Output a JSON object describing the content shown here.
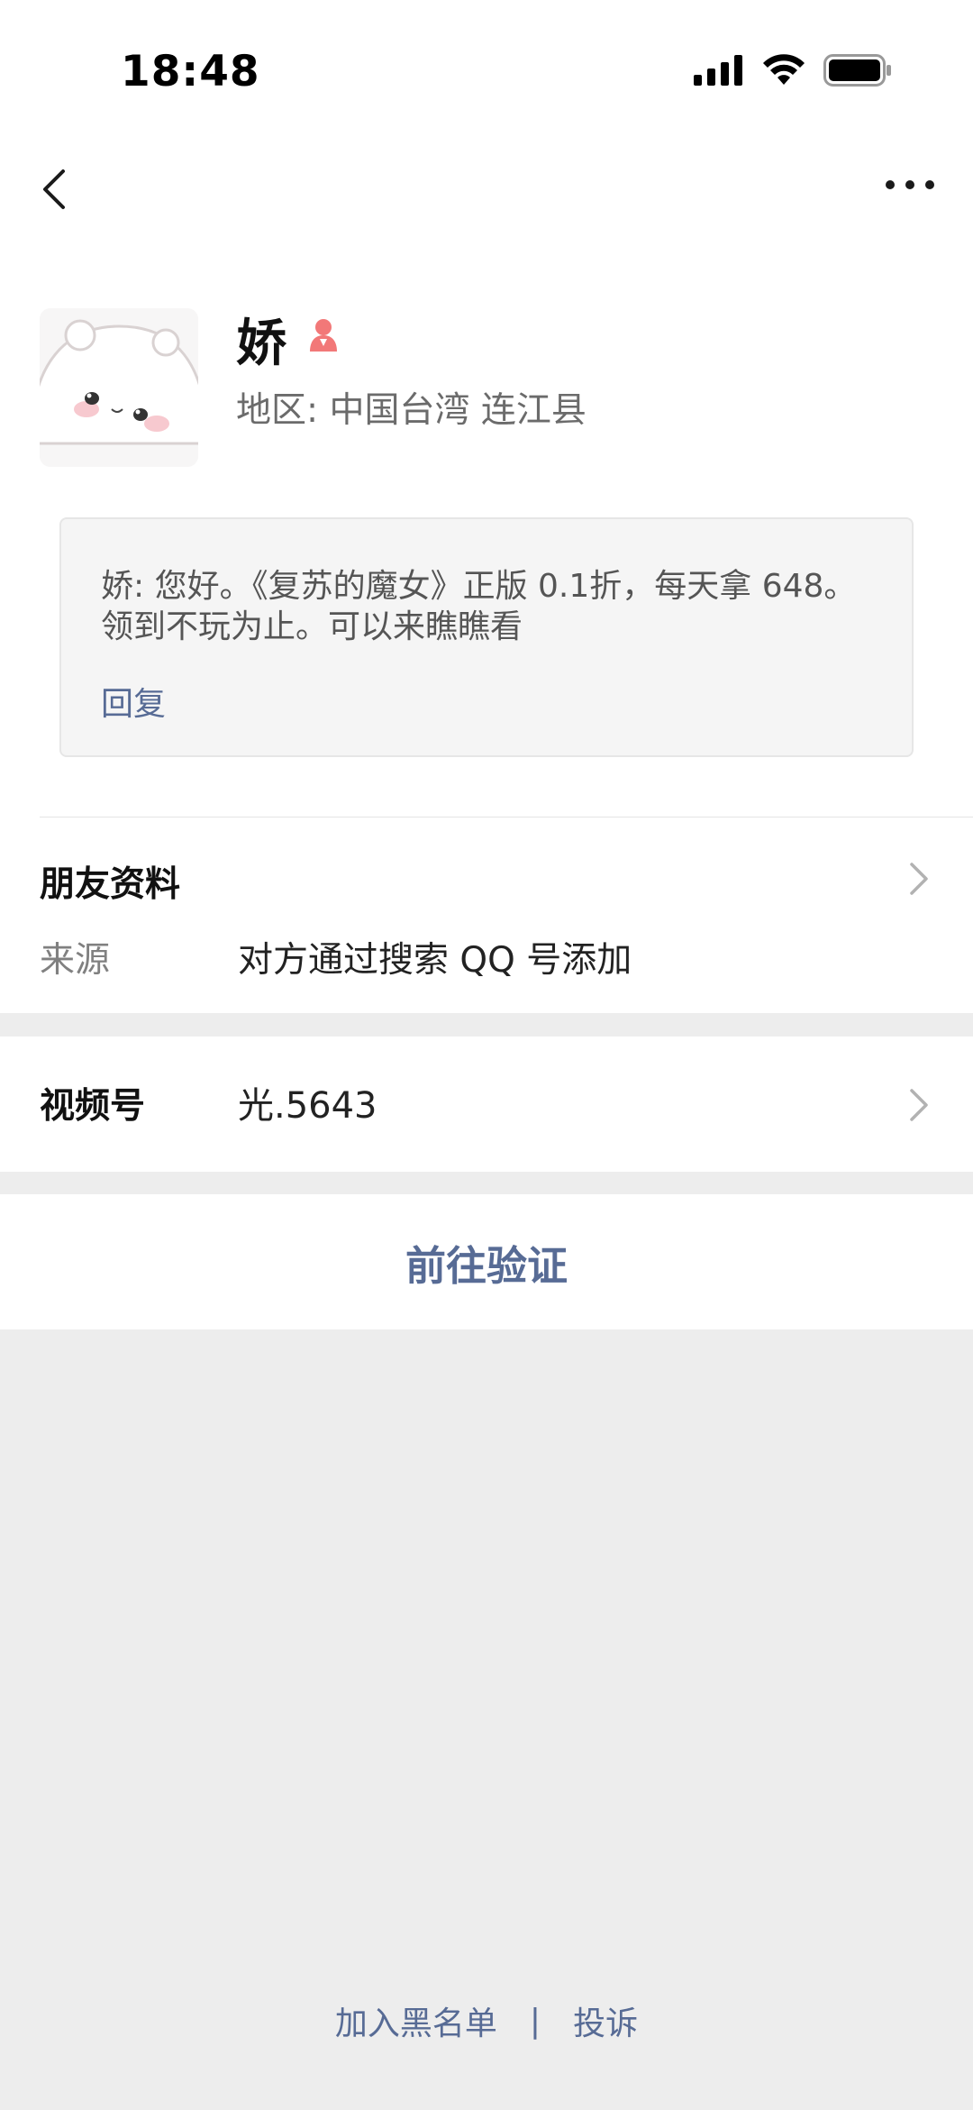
{
  "status_bar": {
    "time": "18:48"
  },
  "nav": {
    "back_icon": "chevron-left-icon",
    "more_icon": "ellipsis-icon"
  },
  "profile": {
    "name": "娇",
    "gender_icon": "female-icon",
    "gender_color": "#fa5151",
    "region": "地区: 中国台湾 连江县"
  },
  "message": {
    "text": "娇: 您好。《复苏的魔女》正版 0.1折，每天拿 648。领到不玩为止。可以来瞧瞧看",
    "reply_label": "回复"
  },
  "friend_info": {
    "title": "朋友资料",
    "source_label": "来源",
    "source_value": "对方通过搜索 QQ 号添加"
  },
  "channels": {
    "label": "视频号",
    "value": "光.5643"
  },
  "actions": {
    "verify_label": "前往验证"
  },
  "footer": {
    "blacklist_label": "加入黑名单",
    "separator": "|",
    "report_label": "投诉"
  },
  "colors": {
    "link": "#576b95",
    "background": "#ededed"
  }
}
